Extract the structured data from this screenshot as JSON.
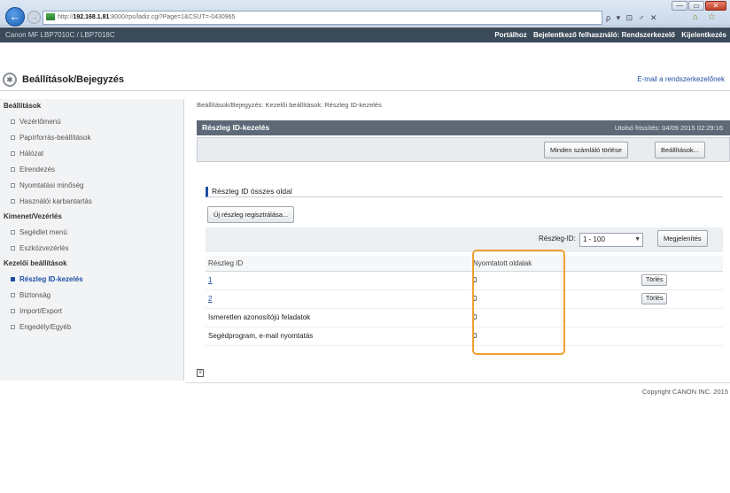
{
  "browser": {
    "address": {
      "scheme": "http://",
      "host": "192.168.1.81",
      "rest": ":8000/rps/ladiz.cgi?Page=1&CSUT=-0430965"
    },
    "address_tools": "ρ ▾ ⊡ ♂ ✕",
    "tools": "⌂ ☆ ⚙",
    "window_buttons": {
      "minimize": "—",
      "maximize": "▭",
      "close": "✕"
    }
  },
  "topbar": {
    "device_name": "Canon MF     LBP7010C / LBP7018C",
    "links": [
      "Portálhoz",
      "Bejelentkező felhasználó: Rendszerkezelő",
      "Kijelentkezés"
    ]
  },
  "header": {
    "title": "Beállítások/Bejegyzés",
    "mail_admin": "E-mail a rendszerkezelőnek"
  },
  "sidebar": {
    "groups": [
      {
        "label": "Beállítások",
        "items": [
          "Vezérlőmenü",
          "Papírforrás-beállítások",
          "Hálózat",
          "Elrendezés",
          "Nyomtatási minőség",
          "Használói karbantartás"
        ]
      },
      {
        "label": "Kimenet/Vezérlés",
        "items": [
          "Segédlet menü",
          "Eszközvezérlés"
        ]
      },
      {
        "label": "Kezelői beállítások",
        "items": [
          "Részleg ID-kezelés",
          "Biztonság",
          "Import/Export",
          "Engedély/Egyéb"
        ]
      }
    ],
    "active_item": "Részleg ID-kezelés"
  },
  "main": {
    "breadcrumb": "Beállítások/Bejegyzés: Kezelői beállítások: Részleg ID-kezelés",
    "panel_title": "Részleg ID-kezelés",
    "last_updated": "Utolsó frissítés: 04/09 2015 02:29:16",
    "toolbar_buttons": {
      "clear_all": "Minden számláló törlése",
      "settings": "Beállítások..."
    },
    "section_title": "Részleg ID összes oldal",
    "register_button": "Új részleg regisztrálása...",
    "filter": {
      "label": "Részleg-ID:",
      "value": "1 - 100",
      "display_button": "Megjelenítés"
    },
    "table": {
      "headers": [
        "Részleg ID",
        "Nyomtatott oldalak"
      ],
      "rows": [
        {
          "id": "1",
          "pages": "0",
          "action": "Törlés"
        },
        {
          "id": "2",
          "pages": "0",
          "action": "Törlés"
        },
        {
          "id": "Ismeretlen azonosítójú feladatok",
          "pages": "0"
        },
        {
          "id": "Segédprogram, e-mail nyomtatás",
          "pages": "0"
        }
      ]
    }
  },
  "footer": {
    "copyright": "Copyright CANON INC. 2015"
  },
  "colors": {
    "accent": "#1f4fa3",
    "highlight": "#f0a030",
    "panel_header": "#5d6976",
    "topbar": "#3a4a58"
  }
}
